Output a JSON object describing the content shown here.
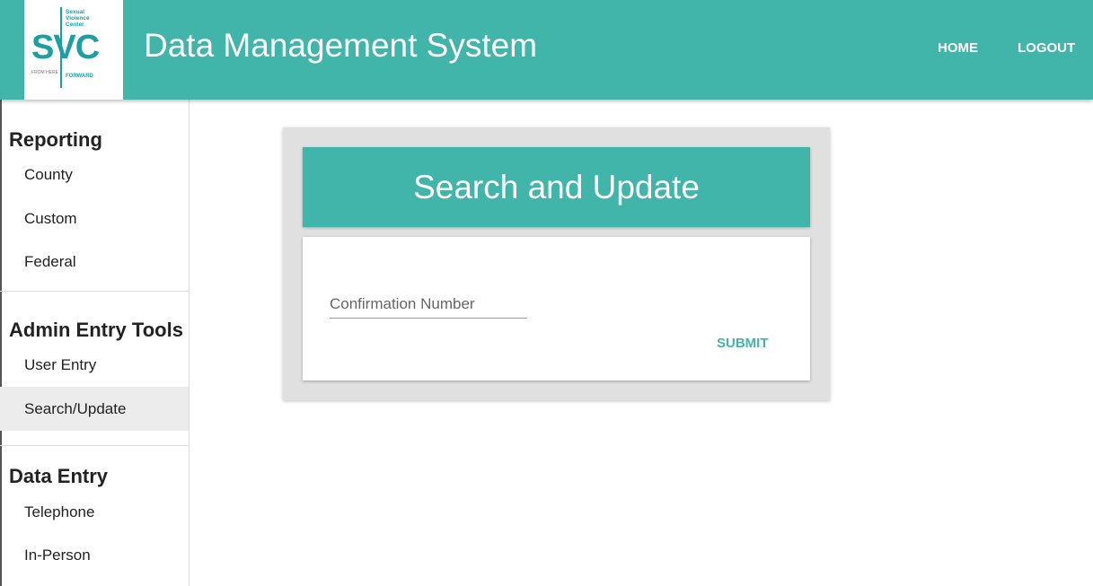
{
  "header": {
    "logo": {
      "letters": "SVC",
      "line1": "Sexual",
      "line2": "Violence",
      "line3": "Center",
      "tag_left": "FROM HERE",
      "tag_right": "FORWARD"
    },
    "title": "Data Management System",
    "nav": {
      "home": "HOME",
      "logout": "LOGOUT"
    },
    "accent_color": "#42b5aa"
  },
  "sidebar": {
    "sections": [
      {
        "title": "Reporting",
        "items": [
          "County",
          "Custom",
          "Federal"
        ]
      },
      {
        "title": "Admin Entry Tools",
        "items": [
          "User Entry",
          "Search/Update"
        ]
      },
      {
        "title": "Data Entry",
        "items": [
          "Telephone",
          "In-Person"
        ]
      }
    ],
    "active_item": "Search/Update"
  },
  "main": {
    "card_title": "Search and Update",
    "confirmation": {
      "placeholder": "Confirmation Number",
      "value": ""
    },
    "submit_label": "SUBMIT"
  }
}
